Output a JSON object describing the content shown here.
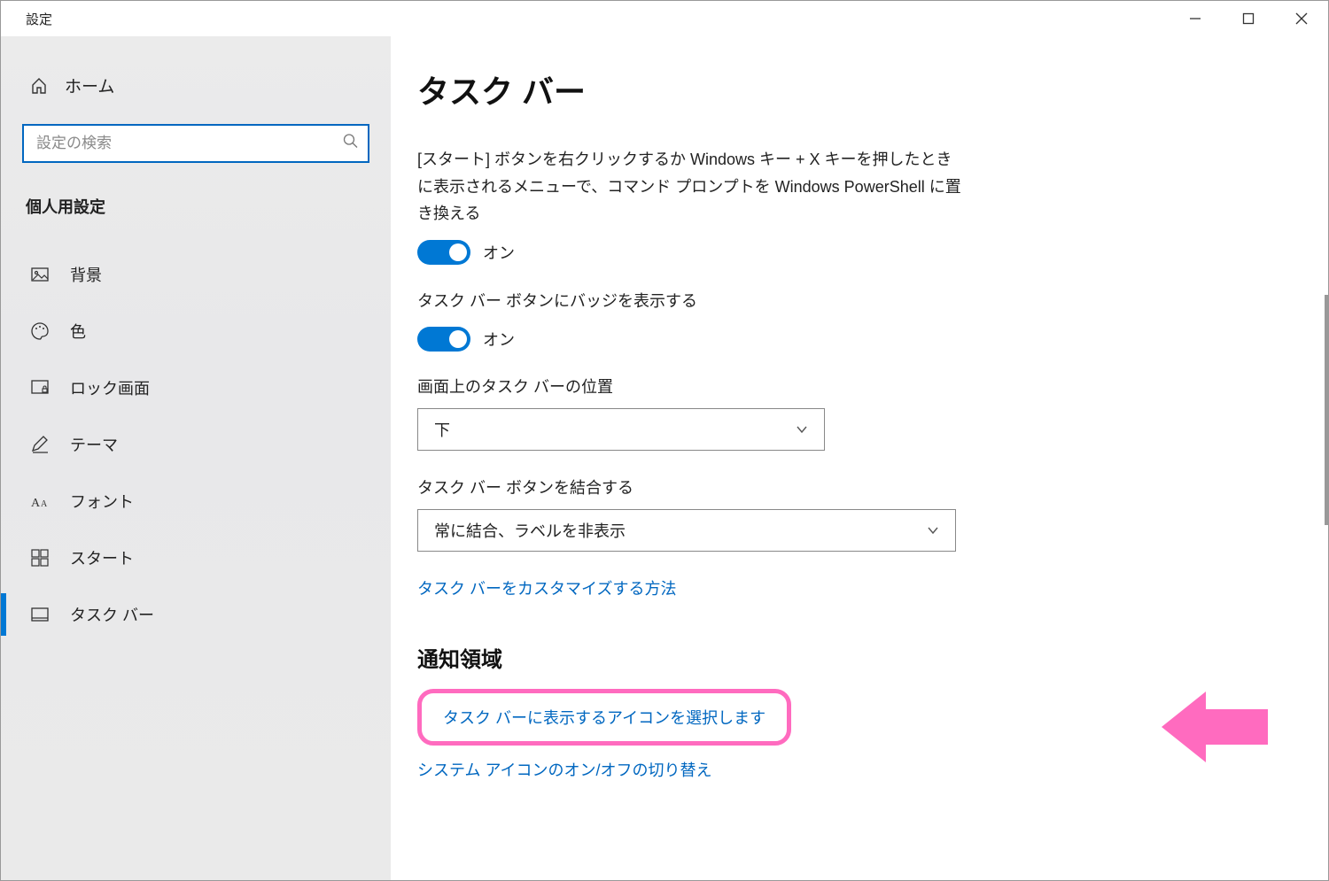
{
  "window": {
    "title": "設定"
  },
  "sidebar": {
    "home": "ホーム",
    "search_placeholder": "設定の検索",
    "section": "個人用設定",
    "items": [
      {
        "label": "背景",
        "icon": "picture-icon"
      },
      {
        "label": "色",
        "icon": "palette-icon"
      },
      {
        "label": "ロック画面",
        "icon": "lock-screen-icon"
      },
      {
        "label": "テーマ",
        "icon": "pencil-icon"
      },
      {
        "label": "フォント",
        "icon": "font-icon"
      },
      {
        "label": "スタート",
        "icon": "start-icon"
      },
      {
        "label": "タスク バー",
        "icon": "taskbar-icon"
      }
    ]
  },
  "main": {
    "title": "タスク バー",
    "setting1": {
      "desc": "[スタート] ボタンを右クリックするか Windows キー + X キーを押したときに表示されるメニューで、コマンド プロンプトを Windows PowerShell に置き換える",
      "state": "オン"
    },
    "setting2": {
      "desc": "タスク バー ボタンにバッジを表示する",
      "state": "オン"
    },
    "setting3": {
      "label": "画面上のタスク バーの位置",
      "value": "下"
    },
    "setting4": {
      "label": "タスク バー ボタンを結合する",
      "value": "常に結合、ラベルを非表示"
    },
    "customize_link": "タスク バーをカスタマイズする方法",
    "section2": {
      "heading": "通知領域",
      "link1": "タスク バーに表示するアイコンを選択します",
      "link2": "システム アイコンのオン/オフの切り替え"
    }
  }
}
